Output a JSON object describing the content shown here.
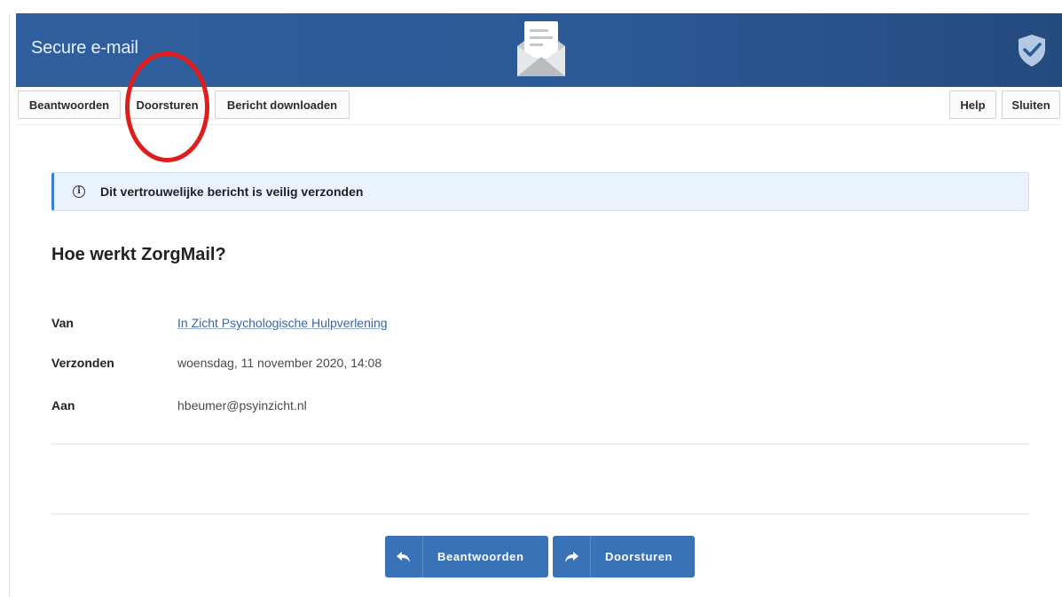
{
  "header": {
    "title": "Secure e-mail",
    "logo_icon": "open-envelope-icon",
    "security_icon": "shield-check-icon",
    "color": "#2f5f9e"
  },
  "toolbar": {
    "reply_label": "Beantwoorden",
    "forward_label": "Doorsturen",
    "download_label": "Bericht downloaden",
    "help_label": "Help",
    "close_label": "Sluiten"
  },
  "annotation": {
    "type": "red-circle",
    "target": "Doorsturen",
    "color": "#e01d1d"
  },
  "banner": {
    "icon": "info-icon",
    "text": "Dit vertrouwelijke bericht is veilig verzonden",
    "accent": "#3b7fd3"
  },
  "message": {
    "subject": "Hoe werkt ZorgMail?",
    "from_label": "Van",
    "from_value": "In Zicht Psychologische Hulpverlening",
    "sent_label": "Verzonden",
    "sent_value": "woensdag, 11 november 2020, 14:08",
    "to_label": "Aan",
    "to_value": "hbeumer@psyinzicht.nl"
  },
  "actions": {
    "reply_label": "Beantwoorden",
    "forward_label": "Doorsturen",
    "color": "#3a72b8"
  }
}
